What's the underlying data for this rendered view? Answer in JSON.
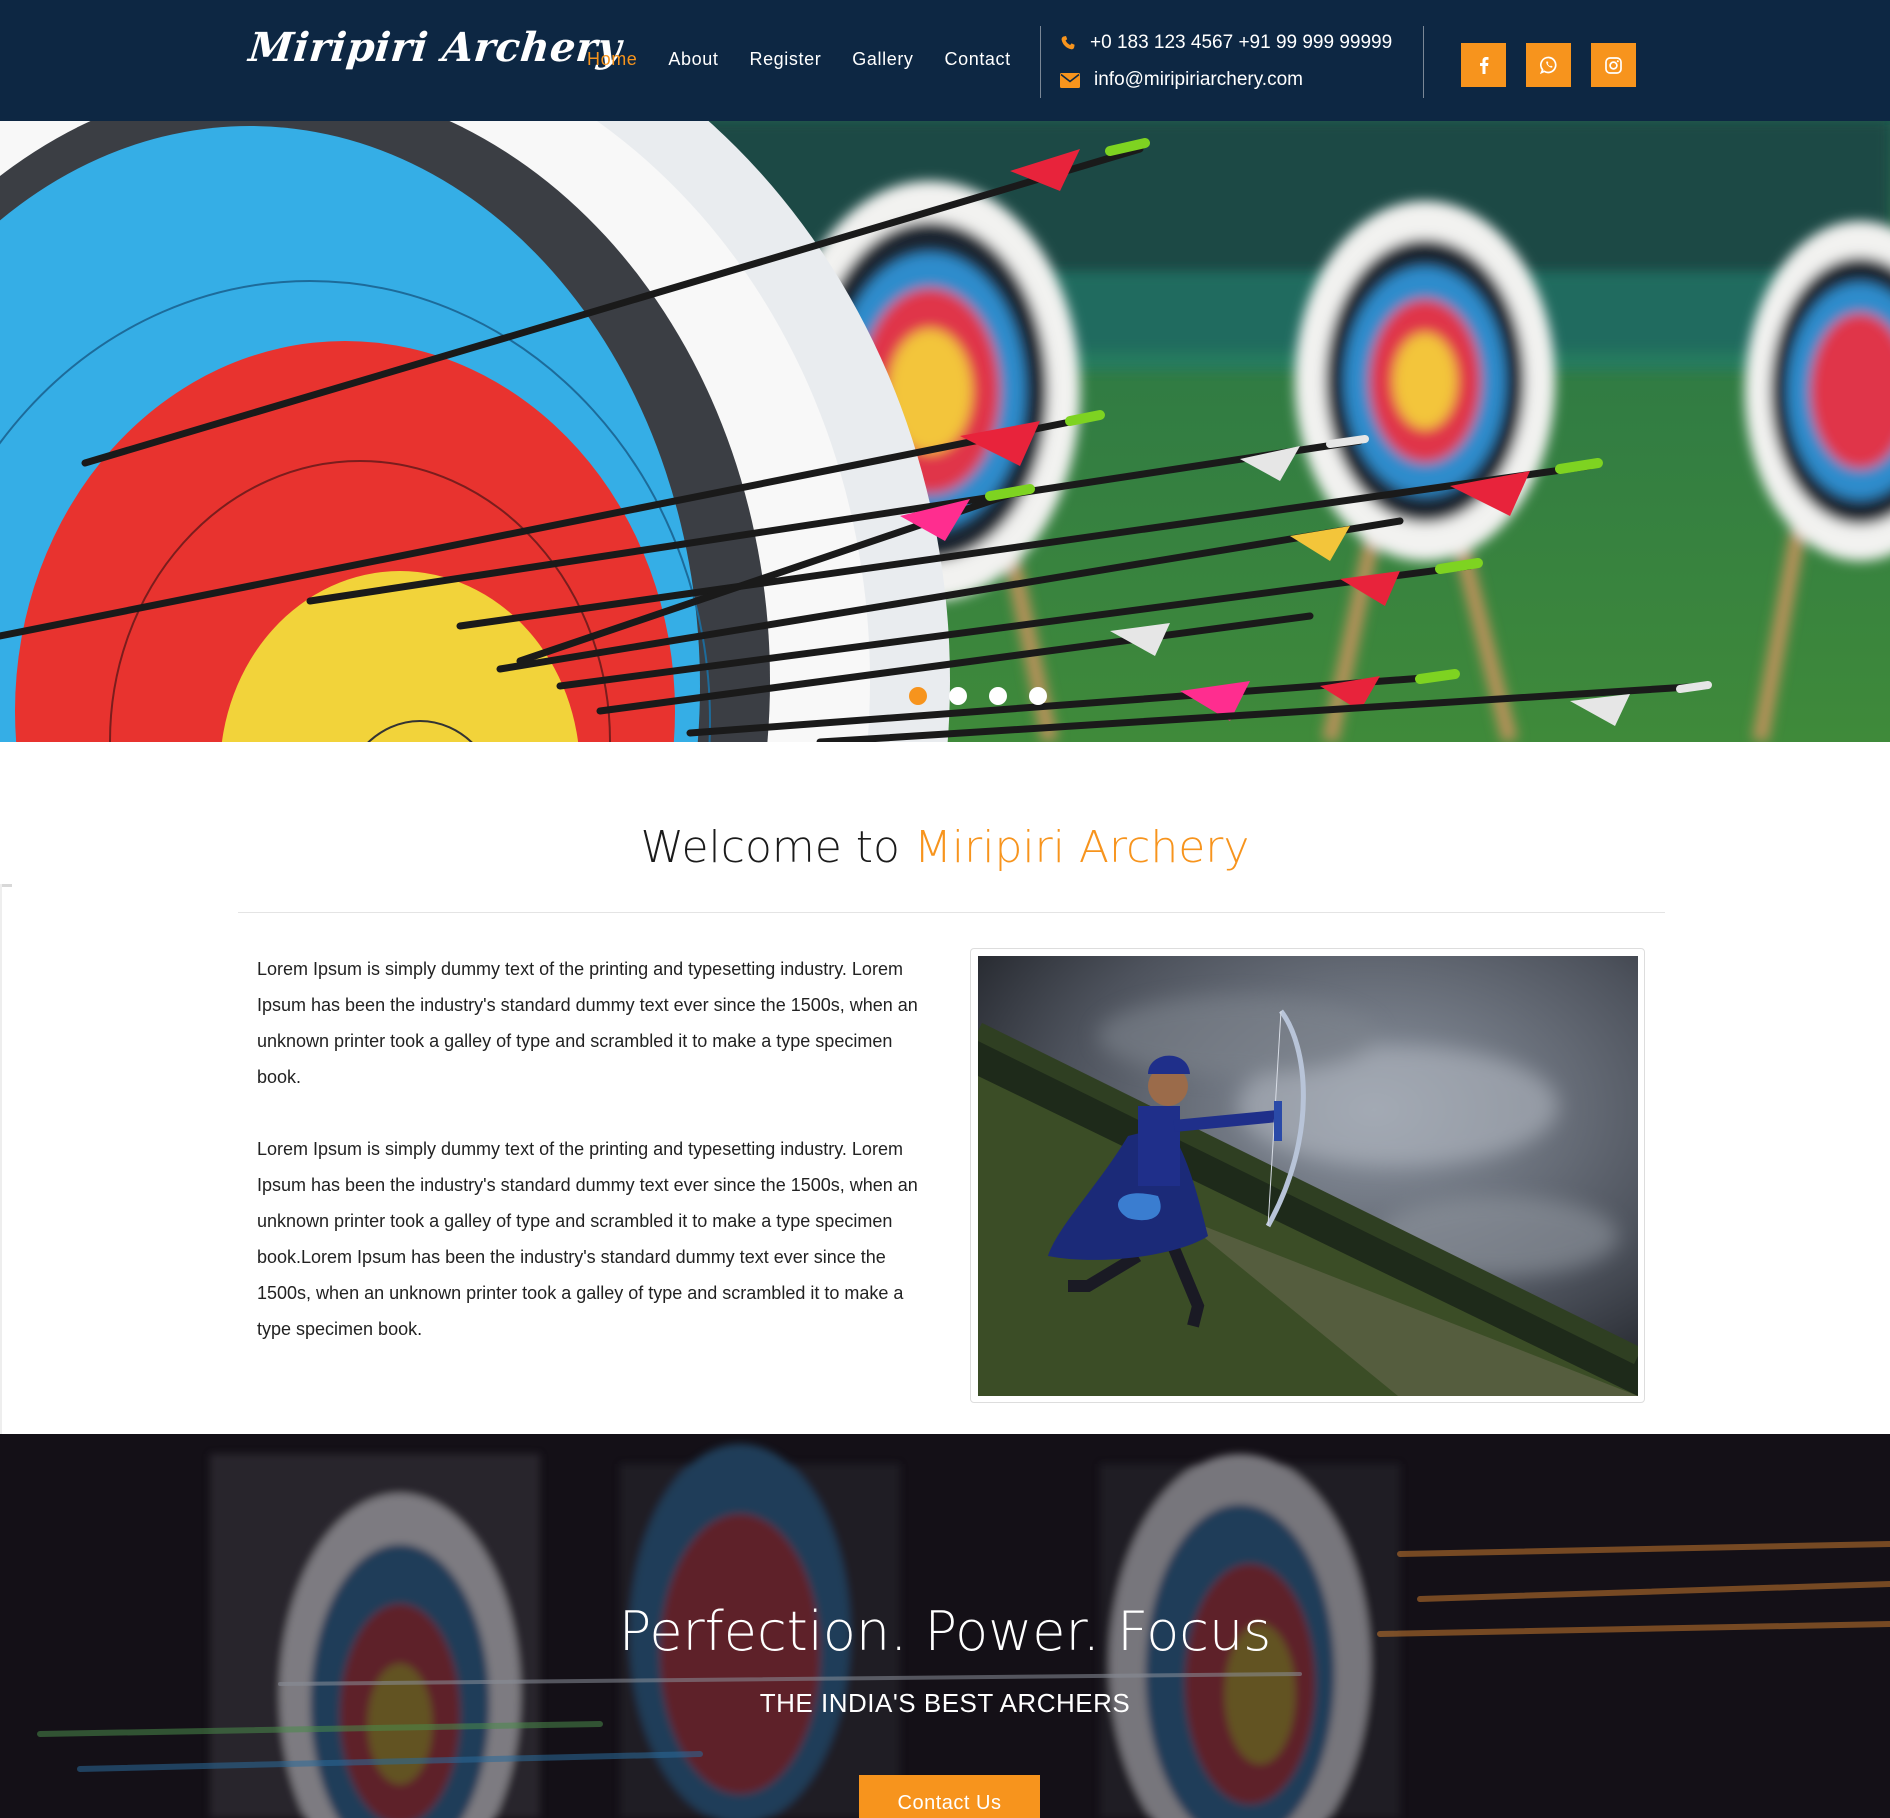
{
  "brand": {
    "logo_text": "Miripiri Archery",
    "accent_color": "#f7941d",
    "header_bg": "#0d2743"
  },
  "nav": {
    "items": [
      {
        "label": "Home",
        "active": true
      },
      {
        "label": "About",
        "active": false
      },
      {
        "label": "Register",
        "active": false
      },
      {
        "label": "Gallery",
        "active": false
      },
      {
        "label": "Contact",
        "active": false
      }
    ]
  },
  "contact": {
    "phone": "+0 183 123 4567 +91 99 999 99999",
    "email": "info@miripiriarchery.com",
    "phone_icon": "phone-icon",
    "email_icon": "envelope-icon"
  },
  "social": [
    {
      "name": "facebook-icon"
    },
    {
      "name": "whatsapp-icon"
    },
    {
      "name": "instagram-icon"
    }
  ],
  "hero": {
    "slides_count": 4,
    "active_slide": 1
  },
  "welcome": {
    "title_prefix": "Welcome to ",
    "title_accent": "Miripiri Archery",
    "paragraphs": [
      "Lorem Ipsum is simply dummy text of the printing and typesetting industry. Lorem Ipsum has been the industry's standard dummy text ever since the 1500s, when an unknown printer took a galley of type and scrambled it to make a type specimen book.",
      "Lorem Ipsum is simply dummy text of the printing and typesetting industry. Lorem Ipsum has been the industry's standard dummy text ever since the 1500s, when an unknown printer took a galley of type and scrambled it to make a type specimen book.Lorem Ipsum has been the industry's standard dummy text ever since the 1500s, when an unknown printer took a galley of type and scrambled it to make a type specimen book."
    ]
  },
  "banner": {
    "title": "Perfection. Power. Focus",
    "subtitle": "THE INDIA'S BEST ARCHERS",
    "cta_label": "Contact Us"
  }
}
